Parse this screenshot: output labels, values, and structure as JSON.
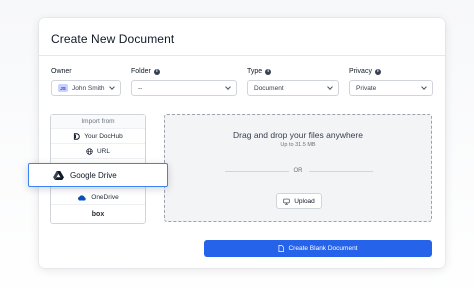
{
  "title": "Create New Document",
  "fields": {
    "owner": {
      "label": "Owner",
      "avatar_initials": "JS",
      "value": "John Smith"
    },
    "folder": {
      "label": "Folder",
      "value": "--"
    },
    "type": {
      "label": "Type",
      "value": "Document"
    },
    "privacy": {
      "label": "Privacy",
      "value": "Private"
    }
  },
  "import": {
    "header": "Import from",
    "items": [
      {
        "label": "Your DocHub",
        "icon": "dochub-icon"
      },
      {
        "label": "URL",
        "icon": "globe-icon"
      },
      {
        "label": "Google Drive",
        "icon": "google-drive-icon"
      },
      {
        "label": "",
        "icon": "dropbox-icon"
      },
      {
        "label": "OneDrive",
        "icon": "onedrive-icon"
      },
      {
        "label": "box",
        "icon": "box-logo"
      }
    ],
    "highlighted": "Google Drive"
  },
  "dropzone": {
    "title": "Drag and drop your files anywhere",
    "subtitle": "Up to 31.5 MB",
    "or": "OR",
    "upload_label": "Upload"
  },
  "create_button": "Create Blank Document",
  "colors": {
    "accent": "#2563eb",
    "highlight_border": "#3b82f6"
  }
}
